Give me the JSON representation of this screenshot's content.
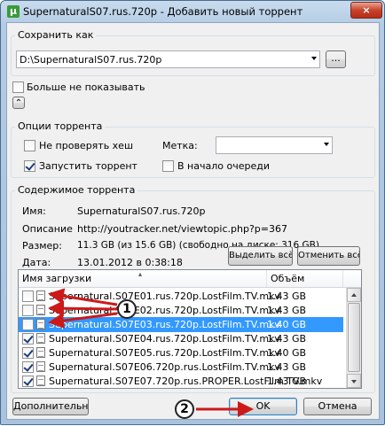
{
  "window": {
    "title": "SupernaturalS07.rus.720p - Добавить новый торрент",
    "app_icon": "µ",
    "close_icon": "×"
  },
  "save": {
    "legend": "Сохранить как",
    "path": "D:\\SupernaturalS07.rus.720p",
    "browse_label": "..."
  },
  "dont_show_label": "Больше не показывать",
  "collapse_icon": "⌃",
  "options": {
    "legend": "Опции торрента",
    "skip_hash_label": "Не проверять хеш",
    "skip_hash_checked": false,
    "start_label": "Запустить торрент",
    "start_checked": true,
    "label_caption": "Метка:",
    "label_value": "",
    "queue_top_label": "В начало очереди",
    "queue_top_checked": false
  },
  "content": {
    "legend": "Содержимое торрента",
    "name_key": "Имя:",
    "name_val": "SupernaturalS07.rus.720p",
    "desc_key": "Описание",
    "desc_val": "http://youtracker.net/viewtopic.php?p=367",
    "size_key": "Размер:",
    "size_val": "11.3 GB (из 15.6 GB) (свободно на диске: 316 GB)",
    "date_key": "Дата:",
    "date_val": "13.01.2012 в 0:38:18",
    "select_all_label": "Выделить всё",
    "deselect_all_label": "Отменить всё",
    "col_name": "Имя загрузки",
    "col_size": "Объём",
    "files": [
      {
        "name": "Supernatural.S07E01.rus.720p.LostFilm.TV.mkv",
        "size": "1.43 GB",
        "checked": false,
        "selected": false
      },
      {
        "name": "Supernatural.S07E02.rus.720p.LostFilm.TV.mkv",
        "size": "1.43 GB",
        "checked": false,
        "selected": false
      },
      {
        "name": "Supernatural.S07E03.rus.720p.LostFilm.TV.mkv",
        "size": "1.40 GB",
        "checked": false,
        "selected": true
      },
      {
        "name": "Supernatural.S07E04.rus.720p.LostFilm.TV.mkv",
        "size": "1.43 GB",
        "checked": true,
        "selected": false
      },
      {
        "name": "Supernatural.S07E05.rus.720p.LostFilm.TV.mkv",
        "size": "1.40 GB",
        "checked": true,
        "selected": false
      },
      {
        "name": "Supernatural.S07E06.720p.rus.LostFilm.TV.mkv",
        "size": "1.43 GB",
        "checked": true,
        "selected": false
      },
      {
        "name": "Supernatural.S07E07.720p.rus.PROPER.LostFilm.TV.mkv",
        "size": "1.43 GB",
        "checked": true,
        "selected": false
      }
    ]
  },
  "footer": {
    "advanced_label": "Дополнительно",
    "ok_label": "OK",
    "cancel_label": "Отмена"
  },
  "annotations": {
    "badge1": "1",
    "badge2": "2",
    "arrow_color": "#cc1a1a"
  }
}
